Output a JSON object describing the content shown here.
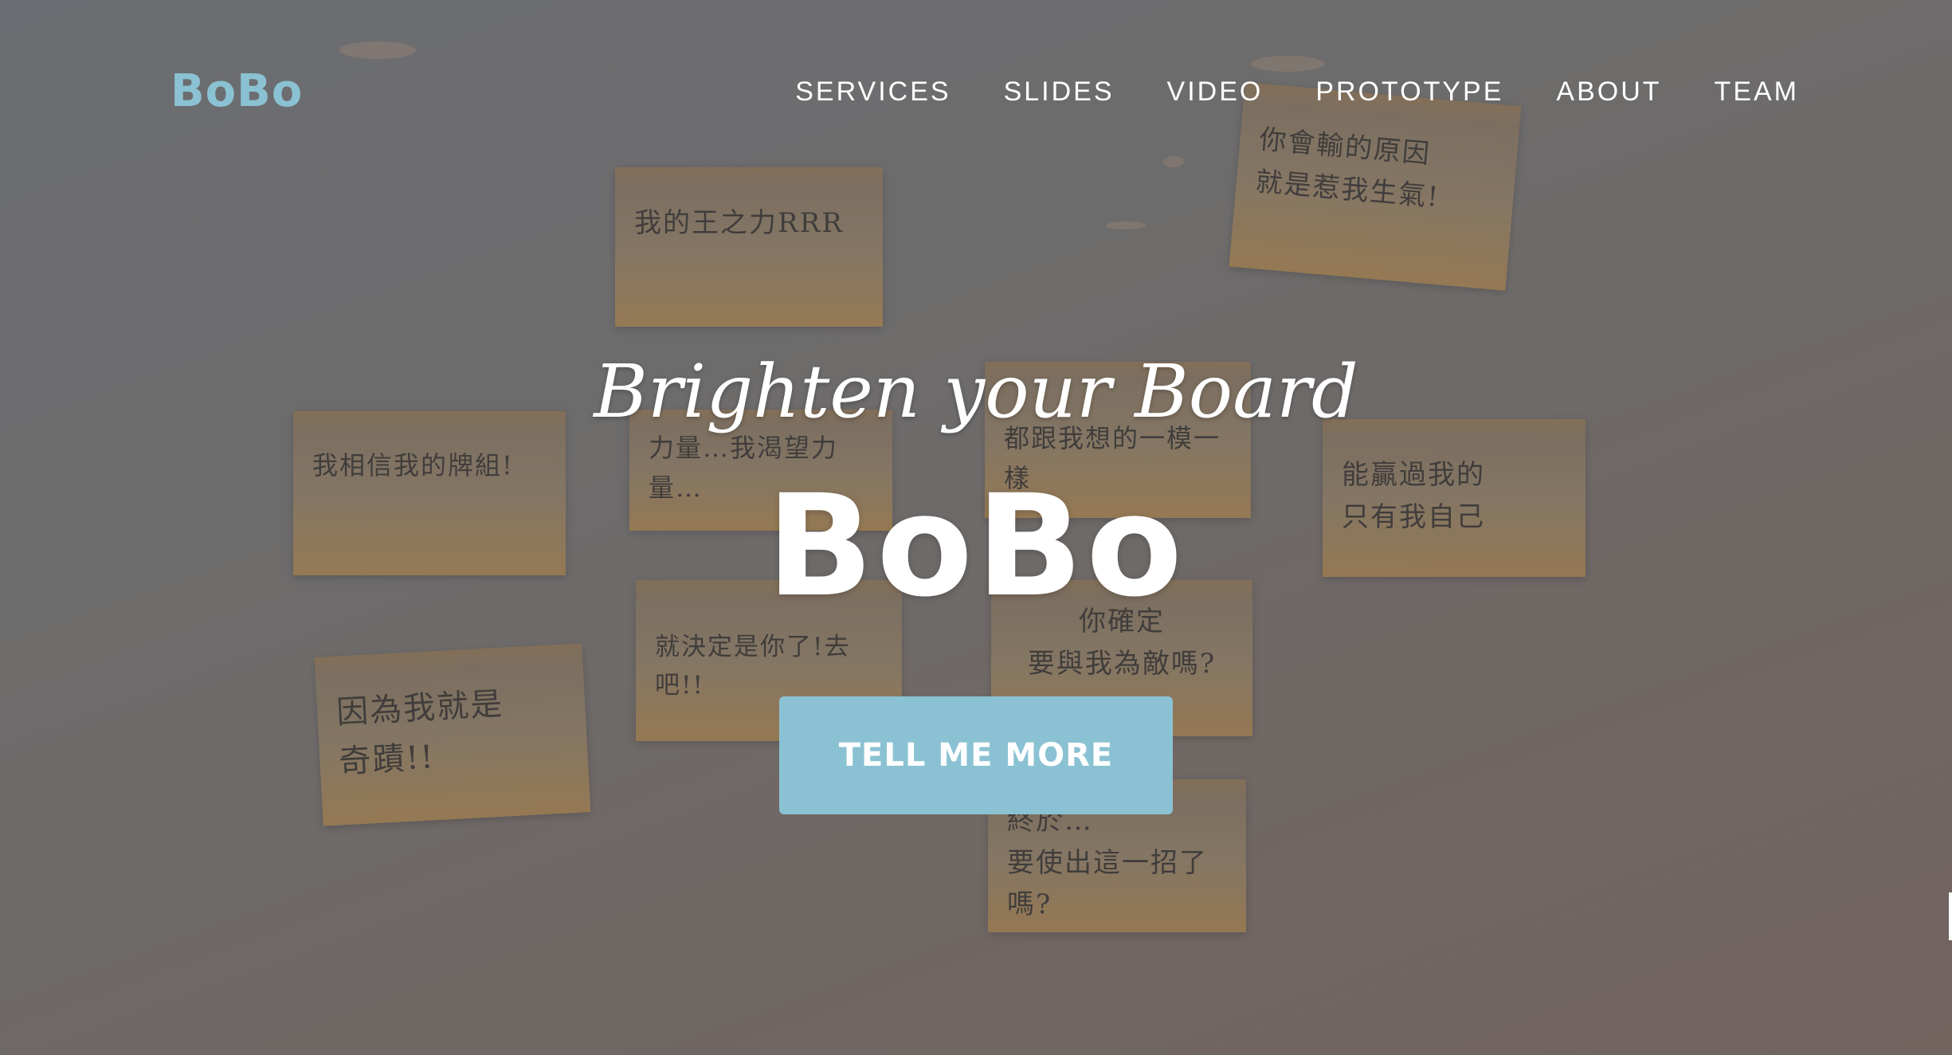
{
  "brand": {
    "logo_text": "BoBo",
    "color": "#8bc2d3"
  },
  "nav": {
    "items": [
      {
        "label": "SERVICES"
      },
      {
        "label": "SLIDES"
      },
      {
        "label": "VIDEO"
      },
      {
        "label": "PROTOTYPE"
      },
      {
        "label": "ABOUT"
      },
      {
        "label": "TEAM"
      }
    ]
  },
  "hero": {
    "tagline": "Brighten your Board",
    "logo_text": "BoBo",
    "cta_label": "TELL ME MORE",
    "cta_color": "#8bc2d3",
    "background_notes": [
      "我的王之力RRR",
      "你會輸的原因\n就是惹我生氣!",
      "我相信我的牌組!",
      "力量…我渴望力量…",
      "都跟我想的一模一樣",
      "能贏過我的\n只有我自己",
      "就決定是你了!去吧!!",
      "你確定\n要與我為敵嗎?",
      "因為我就是\n奇蹟!!",
      "終於…\n要使出這一招了嗎?"
    ]
  }
}
